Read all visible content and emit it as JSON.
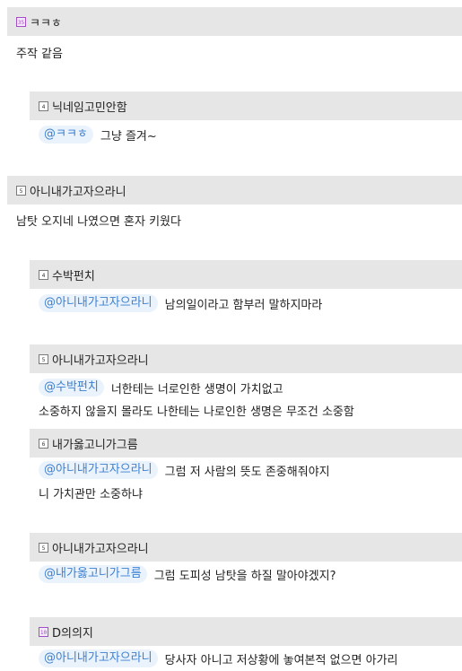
{
  "comments": [
    {
      "level": "35",
      "author": "ㅋㅋㅎ",
      "text": "주작 같음"
    },
    {
      "level": "4",
      "author": "닉네임고민안함",
      "mention": "@ㅋㅋㅎ",
      "text": "그냥 즐겨~"
    },
    {
      "level": "5",
      "author": "아니내가고자으라니",
      "text": "남탓 오지네 나였으면 혼자 키웠다"
    },
    {
      "level": "4",
      "author": "수박펀치",
      "mention": "@아니내가고자으라니",
      "text": "남의일이라고 함부러 말하지마라"
    },
    {
      "level": "5",
      "author": "아니내가고자으라니",
      "mention": "@수박펀치",
      "text": "너한테는 너로인한 생명이 가치없고",
      "text2": "소중하지 않을지 몰라도 나한테는 나로인한 생명은 무조건 소중함"
    },
    {
      "level": "6",
      "author": "내가옳고니가그름",
      "mention": "@아니내가고자으라니",
      "text": "그럼 저 사람의 뜻도 존중해줘야지",
      "text2": "니 가치관만 소중하냐"
    },
    {
      "level": "5",
      "author": "아니내가고자으라니",
      "mention": "@내가옳고니가그름",
      "text": "그럼 도피성 남탓을 하질 말아야겠지?"
    },
    {
      "level": "10",
      "author": "D의의지",
      "mention": "@아니내가고자으라니",
      "text": "당사자 아니고 저상황에 놓여본적 없으면 아가리"
    }
  ]
}
